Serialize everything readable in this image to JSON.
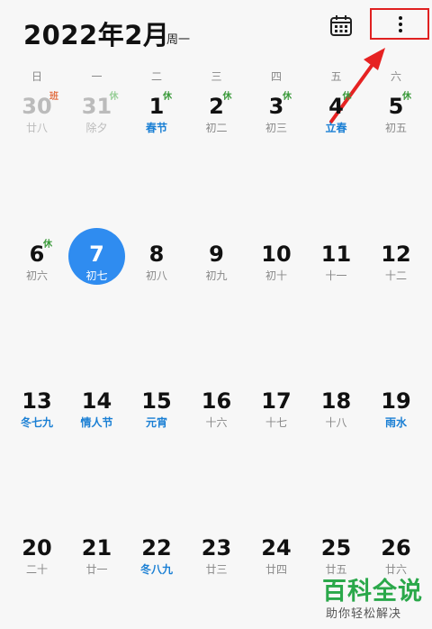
{
  "header": {
    "title": "2022年2月",
    "weekday": "周一"
  },
  "icons": {
    "calendar": "calendar-icon",
    "more": "more-vertical-icon"
  },
  "weekdays": [
    "日",
    "一",
    "二",
    "三",
    "四",
    "五",
    "六"
  ],
  "rows": [
    [
      {
        "day": "30",
        "lunar": "廿八",
        "badge": "班",
        "badge_type": "work",
        "dim": true
      },
      {
        "day": "31",
        "lunar": "除夕",
        "badge": "休",
        "badge_type": "restdim",
        "dim": true
      },
      {
        "day": "1",
        "lunar": "春节",
        "badge": "休",
        "badge_type": "rest",
        "fest": true
      },
      {
        "day": "2",
        "lunar": "初二",
        "badge": "休",
        "badge_type": "rest"
      },
      {
        "day": "3",
        "lunar": "初三",
        "badge": "休",
        "badge_type": "rest"
      },
      {
        "day": "4",
        "lunar": "立春",
        "badge": "休",
        "badge_type": "rest",
        "fest": true
      },
      {
        "day": "5",
        "lunar": "初五",
        "badge": "休",
        "badge_type": "rest"
      }
    ],
    [
      {
        "day": "6",
        "lunar": "初六",
        "badge": "休",
        "badge_type": "rest"
      },
      {
        "day": "7",
        "lunar": "初七",
        "today": true
      },
      {
        "day": "8",
        "lunar": "初八"
      },
      {
        "day": "9",
        "lunar": "初九"
      },
      {
        "day": "10",
        "lunar": "初十"
      },
      {
        "day": "11",
        "lunar": "十一"
      },
      {
        "day": "12",
        "lunar": "十二"
      }
    ],
    [
      {
        "day": "13",
        "lunar": "冬七九",
        "fest": true
      },
      {
        "day": "14",
        "lunar": "情人节",
        "fest": true
      },
      {
        "day": "15",
        "lunar": "元宵",
        "fest": true
      },
      {
        "day": "16",
        "lunar": "十六"
      },
      {
        "day": "17",
        "lunar": "十七"
      },
      {
        "day": "18",
        "lunar": "十八"
      },
      {
        "day": "19",
        "lunar": "雨水",
        "fest": true
      }
    ],
    [
      {
        "day": "20",
        "lunar": "二十"
      },
      {
        "day": "21",
        "lunar": "廿一"
      },
      {
        "day": "22",
        "lunar": "冬八九",
        "fest": true
      },
      {
        "day": "23",
        "lunar": "廿三"
      },
      {
        "day": "24",
        "lunar": "廿四"
      },
      {
        "day": "25",
        "lunar": "廿五"
      },
      {
        "day": "26",
        "lunar": "廿六"
      }
    ]
  ],
  "watermark": {
    "main": "百科全说",
    "sub": "助你轻松解决"
  },
  "colors": {
    "accent": "#2f8cf0",
    "festival": "#1a7fd4",
    "rest": "#3a9a3a",
    "work": "#e3744a",
    "highlight": "#e02020"
  }
}
